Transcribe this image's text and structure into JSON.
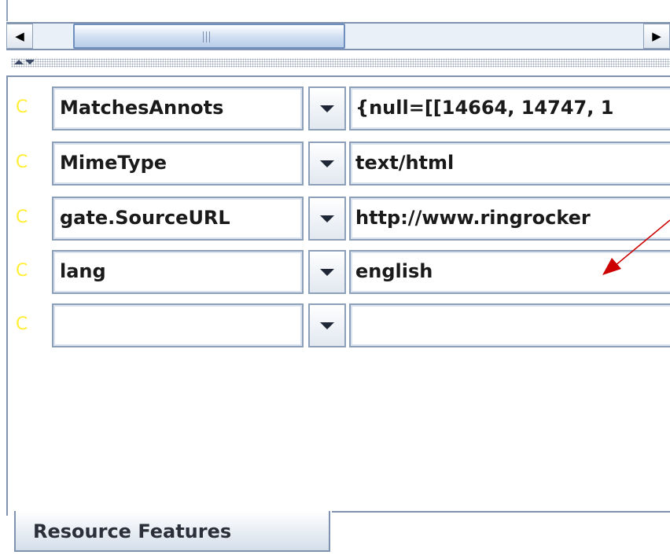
{
  "colors": {
    "accent_border": "#7f93b0",
    "c_marker": "#ffee33",
    "annotation_arrow": "#cc0000"
  },
  "icons": {
    "scroll_left": "triangle-left-icon",
    "scroll_right": "triangle-right-icon",
    "divider_up": "triangle-up-icon",
    "divider_down": "triangle-down-icon",
    "dropdown": "chevron-down-icon"
  },
  "scrollbar": {
    "left_glyph": "◀",
    "right_glyph": "▶"
  },
  "features": {
    "rows": [
      {
        "marker": "C",
        "name": "MatchesAnnots",
        "value": "{null=[[14664, 14747, 1"
      },
      {
        "marker": "C",
        "name": "MimeType",
        "value": "text/html"
      },
      {
        "marker": "C",
        "name": "gate.SourceURL",
        "value": "http://www.ringrocker"
      },
      {
        "marker": "C",
        "name": "lang",
        "value": "english"
      },
      {
        "marker": "C",
        "name": "",
        "value": ""
      }
    ]
  },
  "tabs": {
    "resource_features": "Resource Features"
  }
}
